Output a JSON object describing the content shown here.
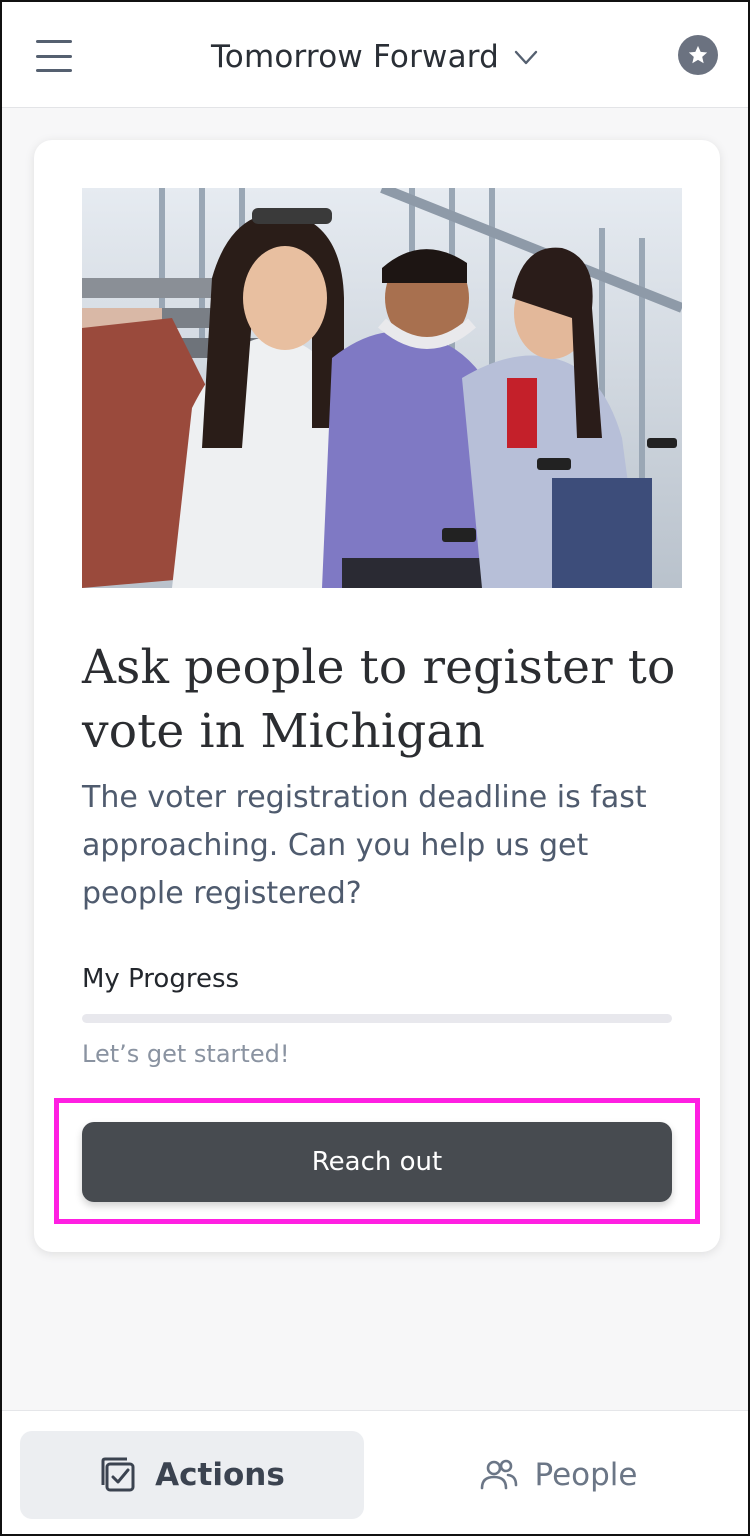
{
  "header": {
    "org_name": "Tomorrow Forward",
    "menu_icon": "hamburger-menu-icon",
    "switch_icon": "chevron-down-icon",
    "favorite_icon": "star-icon"
  },
  "card": {
    "image_alt": "Young people sitting on stairs using phones",
    "title": "Ask people to register to vote in Michigan",
    "description": "The voter registration deadline is fast approaching. Can you help us get people registered?",
    "progress": {
      "label": "My Progress",
      "value": 0,
      "status": "Let’s get started!"
    },
    "cta_label": "Reach out"
  },
  "bottom_nav": {
    "items": [
      {
        "label": "Actions",
        "icon": "checklist-icon",
        "active": true
      },
      {
        "label": "People",
        "icon": "people-icon",
        "active": false
      }
    ]
  },
  "colors": {
    "button": "#474b50",
    "highlight": "#ff1fe2",
    "description_text": "#4f5b6e"
  }
}
